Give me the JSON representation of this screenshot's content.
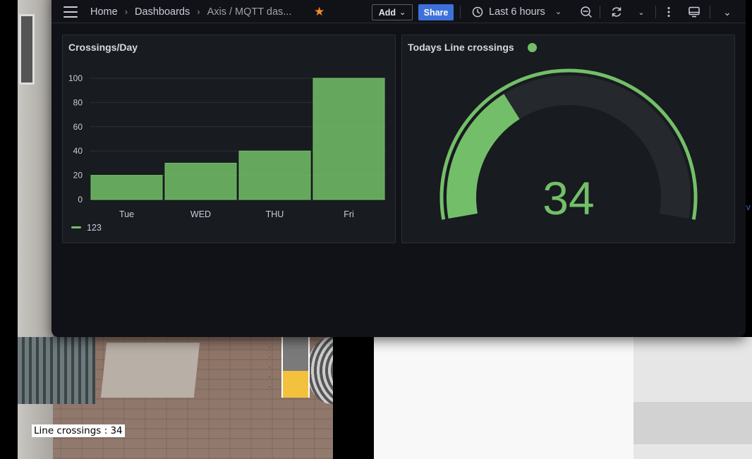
{
  "background": {
    "camera_overlay_label": "Line crossings : 34",
    "edge_text": "v:"
  },
  "topbar": {
    "breadcrumb": [
      "Home",
      "Dashboards",
      "Axis / MQTT das..."
    ],
    "add_label": "Add",
    "share_label": "Share",
    "time_range_label": "Last 6 hours"
  },
  "panels": {
    "left_title": "Crossings/Day",
    "right_title": "Todays Line crossings"
  },
  "chart_data": [
    {
      "type": "bar",
      "title": "Crossings/Day",
      "categories": [
        "Tue",
        "WED",
        "THU",
        "Fri"
      ],
      "series": [
        {
          "name": "123",
          "values": [
            20,
            30,
            40,
            100
          ],
          "color": "#73bf69"
        }
      ],
      "ylim": [
        0,
        100
      ],
      "yticks": [
        0,
        20,
        40,
        60,
        80,
        100
      ],
      "grid": true,
      "legend": "bottom-left"
    },
    {
      "type": "gauge",
      "title": "Todays Line crossings",
      "value": 34,
      "range": [
        0,
        100
      ],
      "color": "#73bf69"
    }
  ],
  "colors": {
    "accent_green": "#73bf69",
    "share_blue": "#3d71d9",
    "star_orange": "#f58a2a",
    "panel_bg": "#181b1f"
  }
}
